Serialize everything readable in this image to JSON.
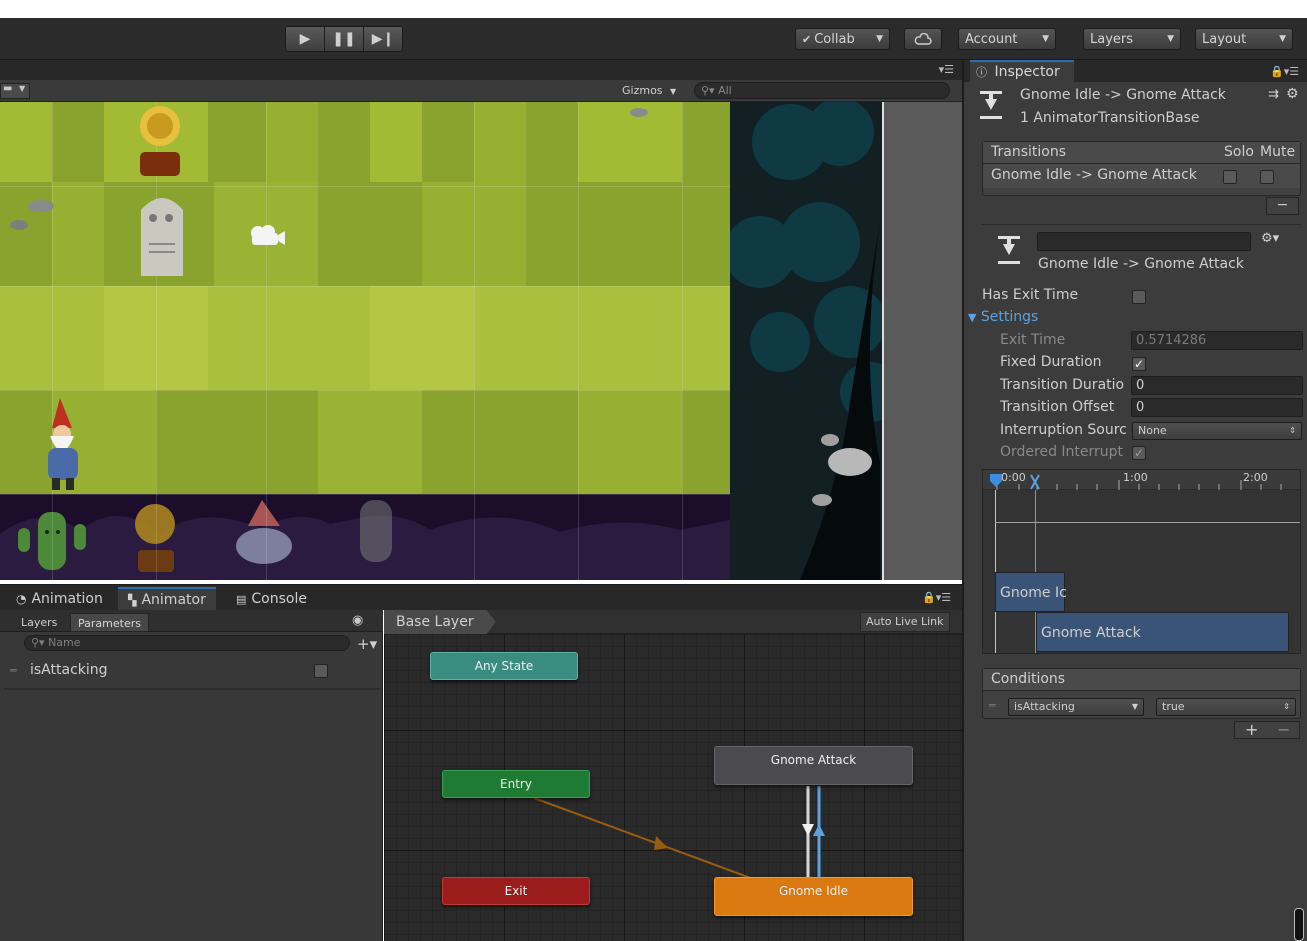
{
  "toolbar": {
    "collab_label": "Collab",
    "account_label": "Account",
    "layers_label": "Layers",
    "layout_label": "Layout"
  },
  "scene": {
    "gizmos_label": "Gizmos",
    "search_placeholder": "All"
  },
  "bottom_tabs": {
    "animation": "Animation",
    "animator": "Animator",
    "console": "Console"
  },
  "parameters_panel": {
    "tab_layers": "Layers",
    "tab_parameters": "Parameters",
    "search_placeholder": "Name",
    "items": [
      {
        "name": "isAttacking",
        "type": "bool",
        "value": false
      }
    ]
  },
  "graph": {
    "breadcrumb": "Base Layer",
    "auto_live_link": "Auto Live Link",
    "nodes": {
      "any_state": "Any State",
      "entry": "Entry",
      "exit": "Exit",
      "gnome_attack": "Gnome Attack",
      "gnome_idle": "Gnome Idle"
    },
    "colors": {
      "any_state": "#3a8c80",
      "entry": "#1f7a33",
      "exit": "#9c1c1c",
      "gnome_attack": "#4a4a4f",
      "gnome_idle": "#d9790f",
      "default_transition": "#9a5c12",
      "selected_transition": "#5aa2e0"
    }
  },
  "inspector": {
    "tab_label": "Inspector",
    "title": "Gnome Idle -> Gnome Attack",
    "subtitle": "1 AnimatorTransitionBase",
    "transitions_header": "Transitions",
    "solo_label": "Solo",
    "mute_label": "Mute",
    "transition_row": "Gnome Idle -> Gnome Attack",
    "transition_name_value": "",
    "transition_caption": "Gnome Idle -> Gnome Attack",
    "has_exit_time_label": "Has Exit Time",
    "has_exit_time": false,
    "settings_label": "Settings",
    "exit_time_label": "Exit Time",
    "exit_time_value": "0.5714286",
    "fixed_duration_label": "Fixed Duration",
    "fixed_duration": true,
    "transition_duration_label": "Transition Duratio",
    "transition_duration_value": "0",
    "transition_offset_label": "Transition Offset",
    "transition_offset_value": "0",
    "interruption_source_label": "Interruption Sourc",
    "interruption_source_value": "None",
    "ordered_interrupt_label": "Ordered Interrupt",
    "ordered_interrupt": true,
    "timeline": {
      "ticks": [
        "0:00",
        "1:00",
        "2:00"
      ],
      "bar_from": "Gnome Ic",
      "bar_to": "Gnome Attack"
    },
    "conditions_header": "Conditions",
    "condition_param": "isAttacking",
    "condition_value": "true"
  }
}
